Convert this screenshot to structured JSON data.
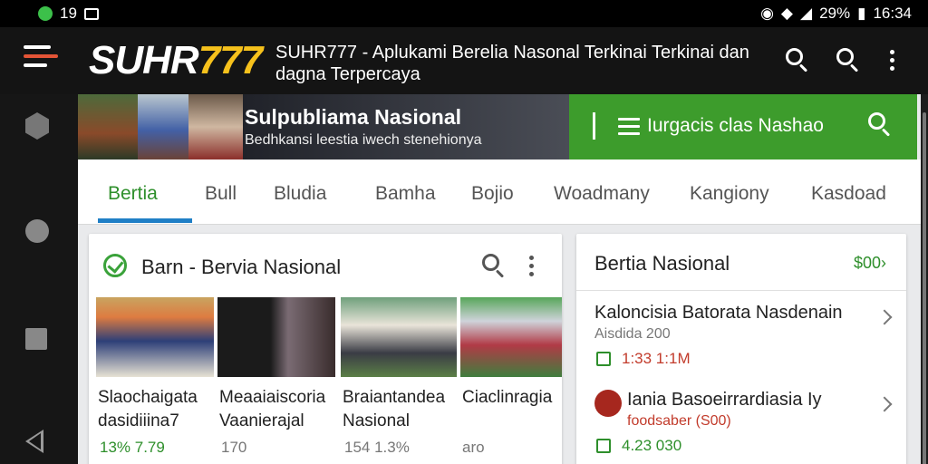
{
  "status_bar": {
    "time_left": "19",
    "battery": "29%",
    "clock": "16:34"
  },
  "header": {
    "logo_white": "SUHR",
    "logo_yellow": "777",
    "title": "SUHR777 - Aplukami Berelia Nasonal Terkinai Terkinai dan dagna Terpercaya"
  },
  "banner": {
    "title": "Sulpubliama Nasional",
    "subtitle": "Bedhkansi leestia iwech stenehionya"
  },
  "green_search": {
    "label": "Iurgacis clas Nashao"
  },
  "tabs": [
    "Bertia",
    "Bull",
    "Bludia",
    "Bamha",
    "Bojio",
    "Woadmany",
    "Kangiony",
    "Kasdoad"
  ],
  "left_card": {
    "title": "Barn - Bervia Nasional",
    "items": [
      {
        "caption_line1": "Slaochaigata",
        "caption_line2": "dasidiiina7",
        "meta": "13%  7.79"
      },
      {
        "caption_line1": "Meaaiaiscoria",
        "caption_line2": "Vaanierajal",
        "meta": "170"
      },
      {
        "caption_line1": "Braiantandea",
        "caption_line2": "Nasional",
        "meta": "154  1.3%"
      },
      {
        "caption_line1": "Ciaclinragia",
        "caption_line2": "",
        "meta": "aro"
      }
    ]
  },
  "right_card": {
    "title": "Bertia Nasional",
    "link": "$00",
    "items": [
      {
        "title": "Kaloncisia Batorata Nasdenain",
        "sub": "Aisdida 200",
        "value": "1:33 1:1M"
      },
      {
        "title": "Iania Basoeirrardiasia Iy",
        "sub": "foodsaber (S00)",
        "value": "4.23 030"
      }
    ]
  },
  "colors": {
    "accent_green": "#3d9c2c",
    "logo_yellow": "#f6c11c",
    "tab_underline": "#1f7fc6"
  }
}
